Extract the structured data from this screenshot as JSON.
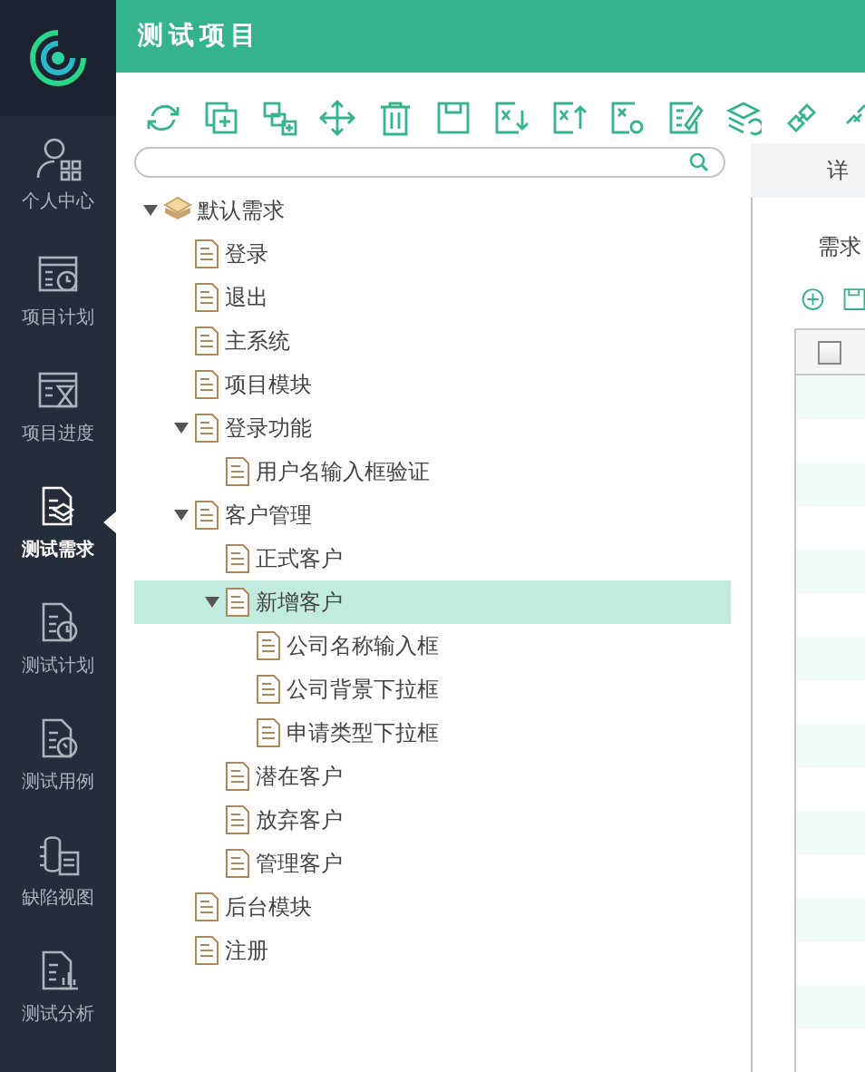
{
  "sidebar": {
    "items": [
      {
        "label": "个人中心",
        "kind": "user",
        "selected": false
      },
      {
        "label": "项目计划",
        "kind": "plan",
        "selected": false
      },
      {
        "label": "项目进度",
        "kind": "progress",
        "selected": false
      },
      {
        "label": "测试需求",
        "kind": "requirement",
        "selected": true
      },
      {
        "label": "测试计划",
        "kind": "testplan",
        "selected": false
      },
      {
        "label": "测试用例",
        "kind": "testcase",
        "selected": false
      },
      {
        "label": "缺陷视图",
        "kind": "bug",
        "selected": false
      },
      {
        "label": "测试分析",
        "kind": "analysis",
        "selected": false
      }
    ]
  },
  "header": {
    "title": "测试项目"
  },
  "toolbar": {
    "tools": [
      {
        "kind": "refresh"
      },
      {
        "kind": "copy"
      },
      {
        "kind": "add-child"
      },
      {
        "kind": "move"
      },
      {
        "kind": "delete"
      },
      {
        "kind": "save"
      },
      {
        "kind": "import"
      },
      {
        "kind": "export"
      },
      {
        "kind": "excel-settings"
      },
      {
        "kind": "edit"
      },
      {
        "kind": "layers"
      },
      {
        "kind": "link"
      },
      {
        "kind": "partial"
      }
    ]
  },
  "tree": [
    {
      "label": "默认需求",
      "kind": "root",
      "expanded": true,
      "selected": false,
      "children": [
        {
          "label": "登录",
          "kind": "doc",
          "selected": false
        },
        {
          "label": "退出",
          "kind": "doc",
          "selected": false
        },
        {
          "label": "主系统",
          "kind": "doc",
          "selected": false
        },
        {
          "label": "项目模块",
          "kind": "doc",
          "selected": false
        },
        {
          "label": "登录功能",
          "kind": "doc",
          "expanded": true,
          "selected": false,
          "children": [
            {
              "label": "用户名输入框验证",
              "kind": "doc",
              "selected": false
            }
          ]
        },
        {
          "label": "客户管理",
          "kind": "doc",
          "expanded": true,
          "selected": false,
          "children": [
            {
              "label": "正式客户",
              "kind": "doc",
              "selected": false
            },
            {
              "label": "新增客户",
              "kind": "doc",
              "expanded": true,
              "selected": true,
              "children": [
                {
                  "label": "公司名称输入框",
                  "kind": "doc",
                  "selected": false
                },
                {
                  "label": "公司背景下拉框",
                  "kind": "doc",
                  "selected": false
                },
                {
                  "label": "申请类型下拉框",
                  "kind": "doc",
                  "selected": false
                }
              ]
            },
            {
              "label": "潜在客户",
              "kind": "doc",
              "selected": false
            },
            {
              "label": "放弃客户",
              "kind": "doc",
              "selected": false
            },
            {
              "label": "管理客户",
              "kind": "doc",
              "selected": false
            }
          ]
        },
        {
          "label": "后台模块",
          "kind": "doc",
          "selected": false
        },
        {
          "label": "注册",
          "kind": "doc",
          "selected": false
        }
      ]
    }
  ],
  "detail": {
    "tab": "详",
    "field_label": "需求",
    "table": {
      "header_checked": false
    }
  }
}
